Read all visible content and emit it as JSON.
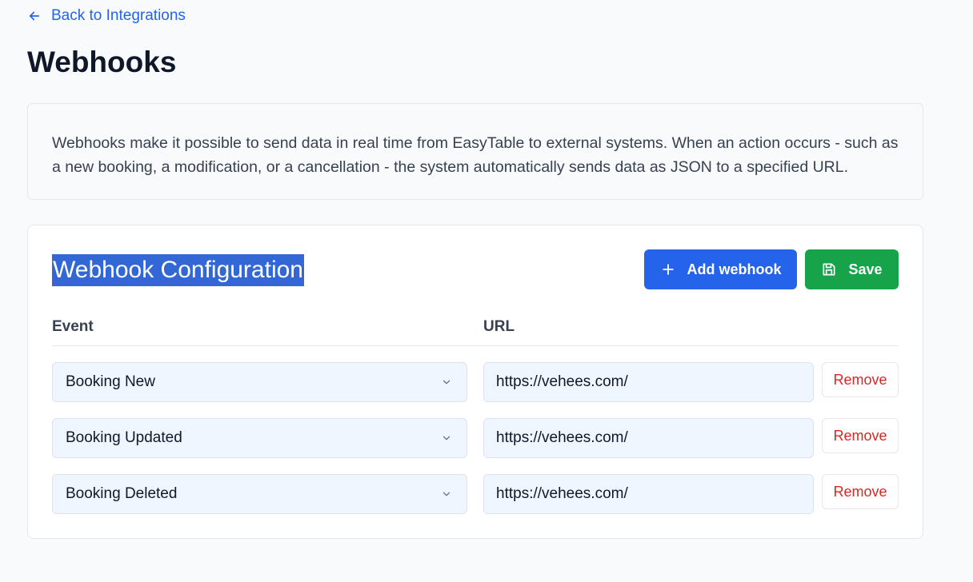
{
  "back_link": {
    "label": "Back to Integrations"
  },
  "page_title": "Webhooks",
  "info": {
    "text": "Webhooks make it possible to send data in real time from EasyTable to external systems. When an action occurs - such as a new booking, a modification, or a cancellation - the system automatically sends data as JSON to a specified URL."
  },
  "config": {
    "title": "Webhook Configuration",
    "add_label": "Add webhook",
    "save_label": "Save",
    "col_event": "Event",
    "col_url": "URL",
    "rows": [
      {
        "event": "Booking New",
        "url": "https://vehees.com/",
        "remove": "Remove"
      },
      {
        "event": "Booking Updated",
        "url": "https://vehees.com/",
        "remove": "Remove"
      },
      {
        "event": "Booking Deleted",
        "url": "https://vehees.com/",
        "remove": "Remove"
      }
    ]
  },
  "colors": {
    "primary": "#2563eb",
    "success": "#16a34a",
    "danger": "#dc2626",
    "selection": "#3367d6"
  },
  "icons": {
    "back": "arrow-left-icon",
    "add": "plus-icon",
    "save": "floppy-disk-icon",
    "select": "chevron-down-icon"
  }
}
